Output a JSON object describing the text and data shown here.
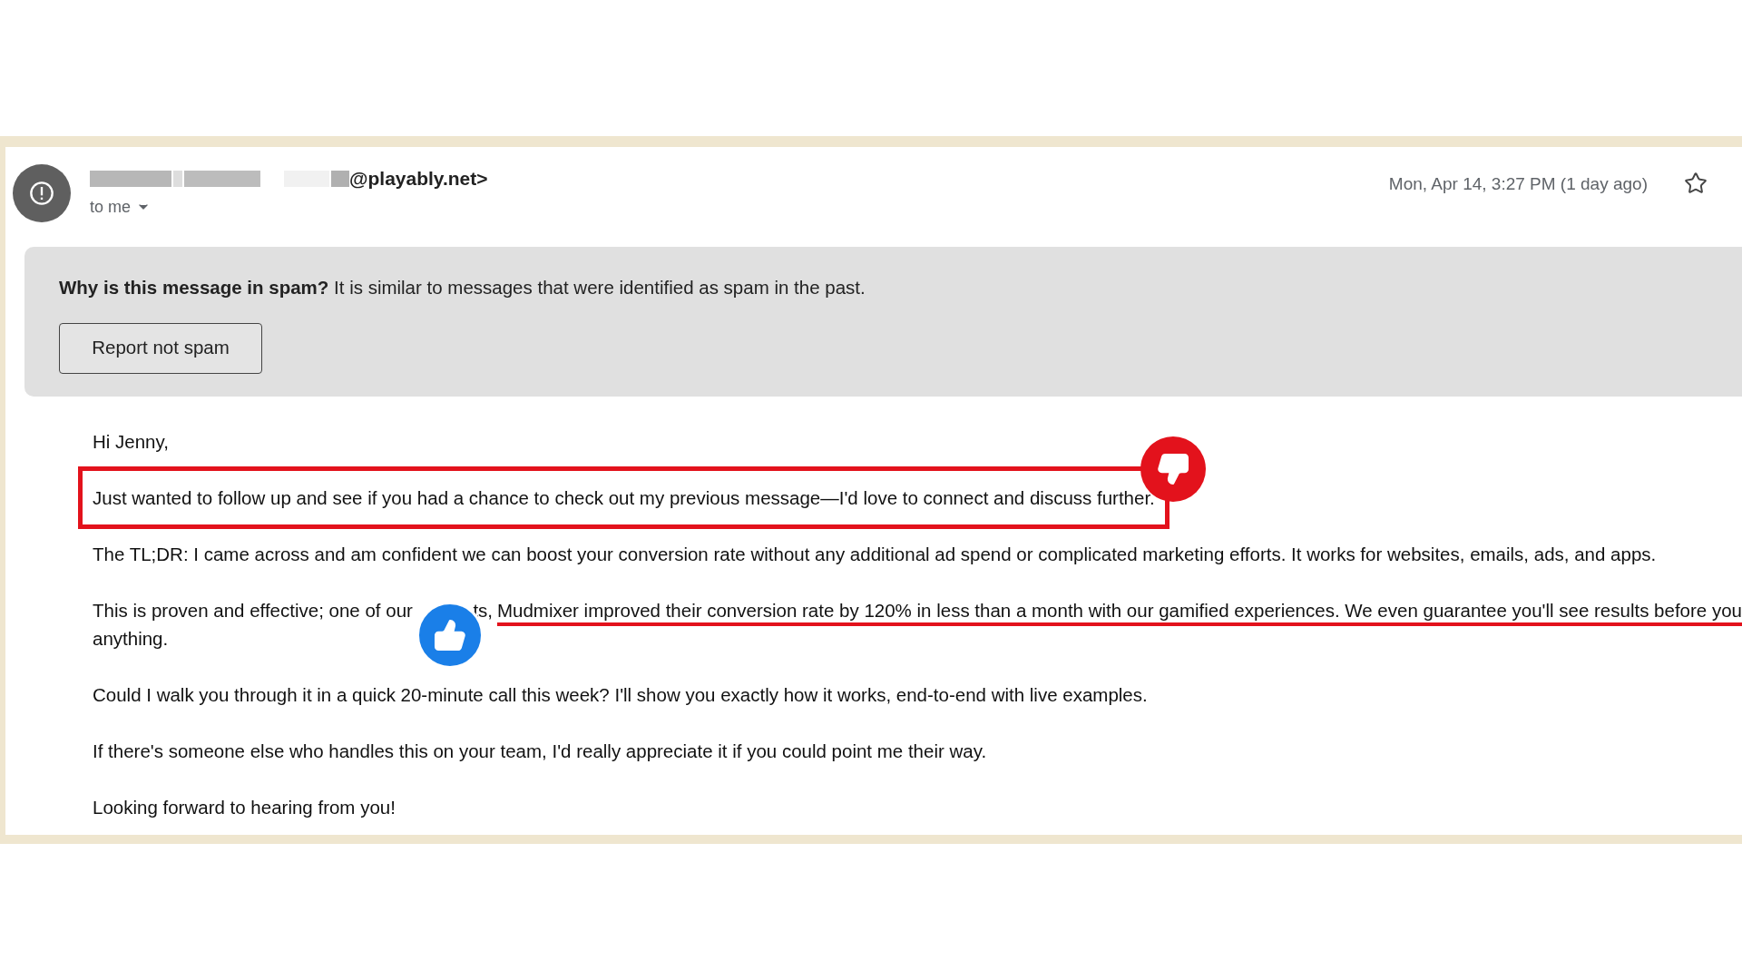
{
  "sender": {
    "visible_address": "@playably.net>",
    "recipient": "to me"
  },
  "date": "Mon, Apr 14, 3:27 PM (1 day ago)",
  "starred": false,
  "spam_notice": {
    "heading": "Why is this message in spam?",
    "text": "It is similar to messages that were identified as spam in the past.",
    "button": "Report not spam"
  },
  "body": [
    {
      "kind": "text",
      "text": "Hi Jenny,"
    },
    {
      "kind": "flagged",
      "text": "Just wanted to follow up and see if you had a chance to check out my previous message—I'd love to connect and discuss further."
    },
    {
      "kind": "text",
      "text": "The TL;DR: I came across  and am confident we can boost your conversion rate without any additional ad spend or complicated marketing efforts. It works for websites, emails, ads, and apps."
    },
    {
      "kind": "praised",
      "before": "This is proven and effective; one of our",
      "after": "ts,",
      "underlined": "Mudmixer improved their conversion rate by 120% in less than a month with our gamified experiences. We even guarantee you'll see results before you",
      "continuation": "anything."
    },
    {
      "kind": "text",
      "text": "Could I walk you through it in a quick 20-minute call this week? I'll show you exactly how it works, end-to-end with live examples."
    },
    {
      "kind": "text",
      "text": "If there's someone else who handles this on your team, I'd really appreciate it if you could point me their way."
    },
    {
      "kind": "text",
      "text": "Looking forward to hearing from you!"
    }
  ]
}
